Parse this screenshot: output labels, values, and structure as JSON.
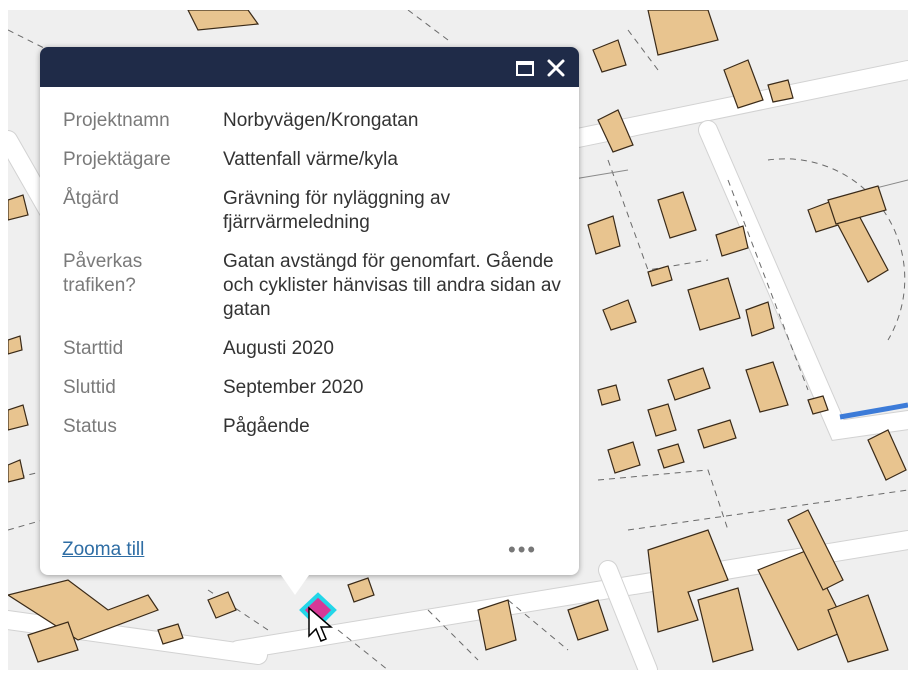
{
  "popup": {
    "fields": [
      {
        "label": "Projektnamn",
        "value": "Norbyvägen/Krongatan"
      },
      {
        "label": "Projektägare",
        "value": "Vattenfall värme/kyla"
      },
      {
        "label": "Åtgärd",
        "value": "Grävning för nyläggning av fjärrvärmeledning"
      },
      {
        "label": "Påverkas trafiken?",
        "value": "Gatan avstängd för genomfart. Gående och cyklister hänvisas till andra sidan av gatan"
      },
      {
        "label": "Starttid",
        "value": "Augusti 2020"
      },
      {
        "label": "Sluttid",
        "value": "September 2020"
      },
      {
        "label": "Status",
        "value": "Pågående"
      }
    ],
    "zoom_link": "Zooma till",
    "more_label": "•••",
    "header_bg": "#1f2b48"
  },
  "map": {
    "building_color": "#e8c48f",
    "background_color": "#efefef",
    "highlight_marker_fill": "#d63a97",
    "highlight_marker_outline": "#22d6e8",
    "cycleway_color": "#3c7bd8"
  },
  "icons": {
    "maximize": "maximize-icon",
    "close": "close-icon",
    "cursor": "mouse-pointer-icon",
    "more": "ellipsis-icon"
  }
}
